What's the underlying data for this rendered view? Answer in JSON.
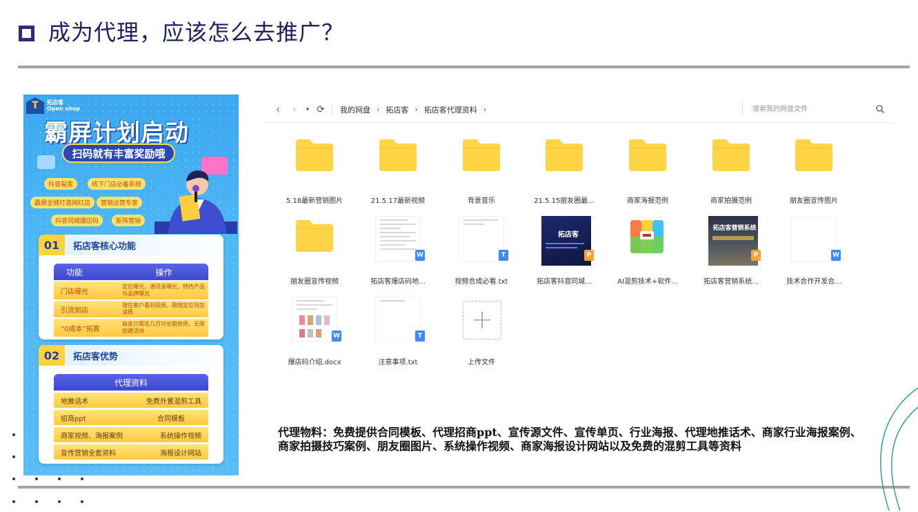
{
  "title": "成为代理，应该怎么去推广？",
  "poster": {
    "logo_cn": "拓店客",
    "logo_en": "Open shop",
    "headline": "霸屏计划启动",
    "banner": "扫码就有丰富奖励哦",
    "tags": [
      "抖音裂变",
      "线下门店必备系统",
      "霸屏全城打造网红店",
      "营销运营专家",
      "抖音同城爆店码",
      "矩阵营销"
    ],
    "section1": {
      "num": "01",
      "title": "拓店客核心功能",
      "header": [
        "功能",
        "操作"
      ],
      "rows": [
        {
          "name": "门店曝光",
          "desc": "定位曝光，通讯录曝光，特色产品与品牌曝光"
        },
        {
          "name": "引流到店",
          "desc": "潜在客户看到视频，跟随定位到店消费"
        },
        {
          "name": "“0成本”拓客",
          "desc": "商家只需花几百可长期使用，无限创建活动"
        }
      ]
    },
    "section2": {
      "num": "02",
      "title": "拓店客优势",
      "header": "代理资料",
      "rows": [
        [
          "地推话术",
          "免费外置混剪工具"
        ],
        [
          "招商ppt",
          "合同模板"
        ],
        [
          "商家视频、海报案例",
          "系统操作视频"
        ],
        [
          "宣传营销全套资料",
          "海报设计网站"
        ]
      ]
    }
  },
  "file_manager": {
    "breadcrumb": [
      "我的网盘",
      "拓店客",
      "拓店客代理资料"
    ],
    "search_placeholder": "搜索我的网盘文件",
    "items": [
      {
        "label": "5.18最新营销图片",
        "kind": "folder"
      },
      {
        "label": "21.5.17最新视频",
        "kind": "folder"
      },
      {
        "label": "背景音乐",
        "kind": "folder"
      },
      {
        "label": "21.5.15朋友圈最...",
        "kind": "folder"
      },
      {
        "label": "商家海报范例",
        "kind": "folder"
      },
      {
        "label": "商家拍摄范例",
        "kind": "folder"
      },
      {
        "label": "朋友圈宣传图片",
        "kind": "folder"
      },
      {
        "label": "朋友圈宣传视频",
        "kind": "folder"
      },
      {
        "label": "拓店客爆店码地...",
        "kind": "word"
      },
      {
        "label": "视频合成必看.txt",
        "kind": "txt"
      },
      {
        "label": "拓店客抖音同城...",
        "kind": "ppt-dark",
        "thumb_text": "拓店客"
      },
      {
        "label": "AI混剪技术+软件...",
        "kind": "archive"
      },
      {
        "label": "拓店客营销系统...",
        "kind": "ppt-photo",
        "thumb_text": "拓店客营销系统"
      },
      {
        "label": "技术合作开发合...",
        "kind": "word-blank"
      },
      {
        "label": "爆店码介绍.docx",
        "kind": "word-pics"
      },
      {
        "label": "注意事项.txt",
        "kind": "txt-blank"
      },
      {
        "label": "上传文件",
        "kind": "upload"
      }
    ],
    "badges": {
      "word": "W",
      "txt": "T",
      "ppt": "P"
    },
    "colors": {
      "folder": "#FFD445",
      "word": "#3E8BF5",
      "txt": "#3E8BF5",
      "ppt": "#F7A23B"
    }
  },
  "description": "代理物料：免费提供合同模板、代理招商ppt、宣传源文件、宣传单页、行业海报、代理地推话术、商家行业海报案例、商家拍摄技巧案例、朋友圈图片、系统操作视频、商家海报设计网站以及免费的混剪工具等资料"
}
